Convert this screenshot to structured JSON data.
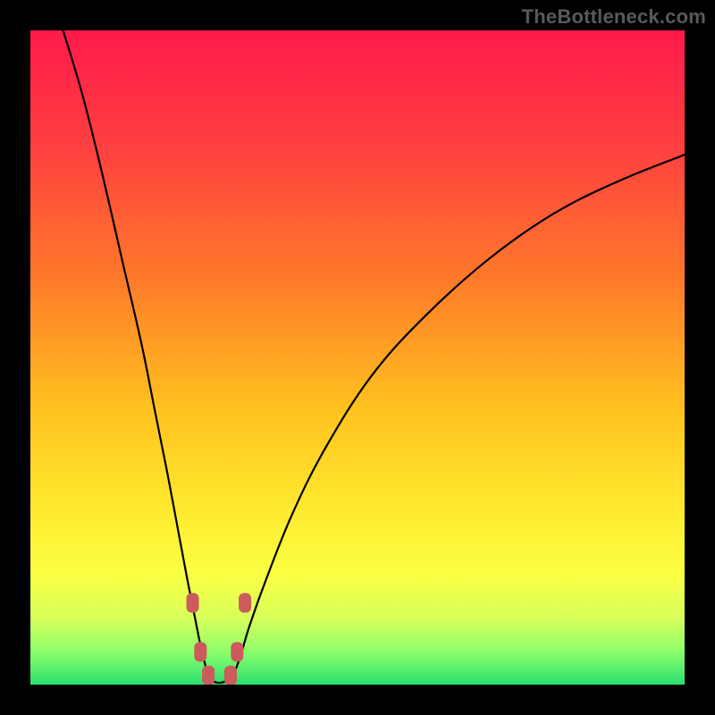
{
  "watermark": "TheBottleneck.com",
  "colors": {
    "frame": "#000000",
    "watermark": "#595959",
    "curve": "#000000",
    "marker_fill": "#cc5b5b",
    "gradient_stops": [
      {
        "offset": 0.0,
        "color": "#ff1a4b"
      },
      {
        "offset": 0.18,
        "color": "#ff4040"
      },
      {
        "offset": 0.38,
        "color": "#ff7a2a"
      },
      {
        "offset": 0.58,
        "color": "#ffc21f"
      },
      {
        "offset": 0.73,
        "color": "#ffe92e"
      },
      {
        "offset": 0.83,
        "color": "#fbff42"
      },
      {
        "offset": 0.9,
        "color": "#d6ff5b"
      },
      {
        "offset": 0.95,
        "color": "#8cff6b"
      },
      {
        "offset": 1.0,
        "color": "#28e06f"
      }
    ]
  },
  "chart_data": {
    "type": "line",
    "title": "",
    "xlabel": "",
    "ylabel": "",
    "xlim": [
      0,
      100
    ],
    "ylim": [
      0,
      100
    ],
    "grid": false,
    "series": [
      {
        "name": "left-curve",
        "x": [
          5,
          8,
          11,
          14,
          17,
          19,
          21,
          22.5,
          24,
          25.2,
          26,
          26.6,
          27,
          27.3,
          27.6
        ],
        "y": [
          100,
          90,
          78,
          65,
          52,
          42,
          32,
          24,
          16,
          10,
          6,
          3.5,
          2,
          1,
          0.8
        ]
      },
      {
        "name": "right-curve",
        "x": [
          30.5,
          31,
          32,
          33.5,
          36,
          40,
          45,
          52,
          60,
          70,
          80,
          90,
          100
        ],
        "y": [
          0.8,
          1.5,
          4,
          9,
          16,
          26,
          36,
          47,
          56,
          65,
          72,
          77,
          81
        ]
      },
      {
        "name": "valley-floor",
        "x": [
          27.6,
          28,
          28.6,
          29.2,
          29.8,
          30.5
        ],
        "y": [
          0.8,
          0.5,
          0.3,
          0.3,
          0.5,
          0.8
        ]
      }
    ],
    "markers": [
      {
        "x": 24.8,
        "y": 12.5
      },
      {
        "x": 26.0,
        "y": 5.0
      },
      {
        "x": 27.2,
        "y": 1.4
      },
      {
        "x": 30.6,
        "y": 1.4
      },
      {
        "x": 31.6,
        "y": 5.0
      },
      {
        "x": 32.8,
        "y": 12.5
      }
    ]
  }
}
